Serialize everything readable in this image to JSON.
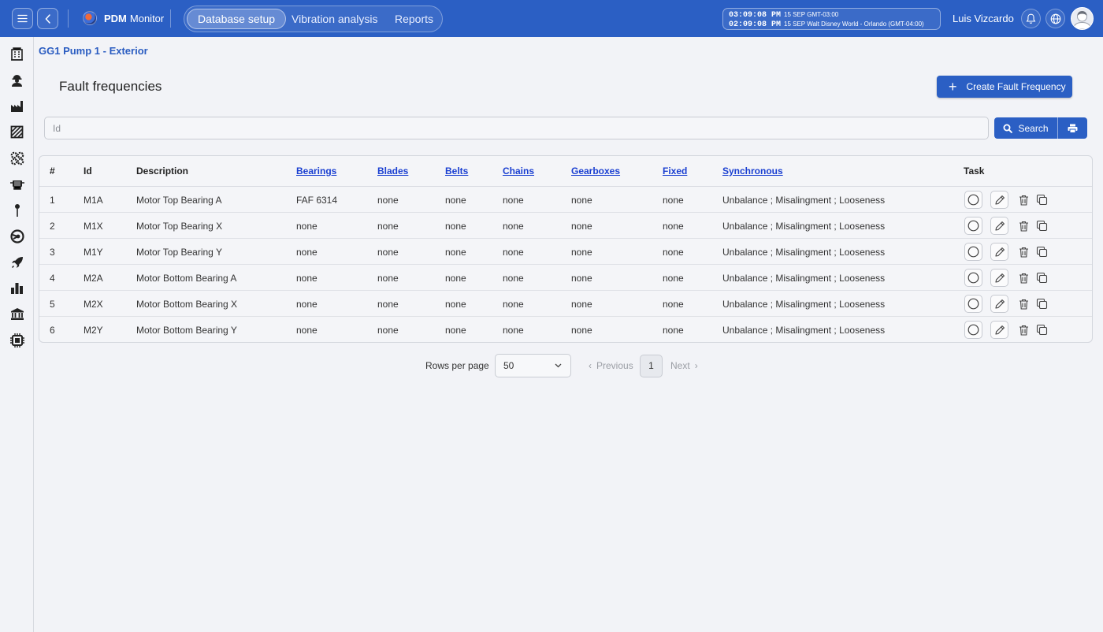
{
  "app": {
    "name_bold": "PDM",
    "name_rest": "Monitor"
  },
  "nav": {
    "tabs": [
      {
        "label": "Database setup",
        "active": true
      },
      {
        "label": "Vibration analysis",
        "active": false
      },
      {
        "label": "Reports",
        "active": false
      }
    ]
  },
  "clock": {
    "line1_time": "03:09:08 PM",
    "line1_info": "15 SEP  GMT-03:00",
    "line2_time": "02:09:08 PM",
    "line2_info": "15 SEP  Walt Disney World - Orlando (GMT-04:00)"
  },
  "user": {
    "name": "Luis Vizcardo"
  },
  "breadcrumb": "GG1 Pump 1 - Exterior",
  "page": {
    "title": "Fault frequencies",
    "create_label": "Create Fault Frequency"
  },
  "search": {
    "placeholder": "Id",
    "button_label": "Search"
  },
  "table": {
    "headers": [
      "#",
      "Id",
      "Description",
      "Bearings",
      "Blades",
      "Belts",
      "Chains",
      "Gearboxes",
      "Fixed",
      "Synchronous",
      "Task"
    ],
    "rows": [
      [
        "1",
        "M1A",
        "Motor Top Bearing A",
        "FAF 6314",
        "none",
        "none",
        "none",
        "none",
        "none",
        "Unbalance ; Misalingment ; Looseness"
      ],
      [
        "2",
        "M1X",
        "Motor Top Bearing X",
        "none",
        "none",
        "none",
        "none",
        "none",
        "none",
        "Unbalance ; Misalingment ; Looseness"
      ],
      [
        "3",
        "M1Y",
        "Motor Top Bearing Y",
        "none",
        "none",
        "none",
        "none",
        "none",
        "none",
        "Unbalance ; Misalingment ; Looseness"
      ],
      [
        "4",
        "M2A",
        "Motor Bottom Bearing A",
        "none",
        "none",
        "none",
        "none",
        "none",
        "none",
        "Unbalance ; Misalingment ; Looseness"
      ],
      [
        "5",
        "M2X",
        "Motor Bottom Bearing X",
        "none",
        "none",
        "none",
        "none",
        "none",
        "none",
        "Unbalance ; Misalingment ; Looseness"
      ],
      [
        "6",
        "M2Y",
        "Motor Bottom Bearing Y",
        "none",
        "none",
        "none",
        "none",
        "none",
        "none",
        "Unbalance ; Misalingment ; Looseness"
      ]
    ]
  },
  "pagination": {
    "rows_label": "Rows per page",
    "rows_value": "50",
    "prev": "Previous",
    "page": "1",
    "next": "Next"
  },
  "colors": {
    "primary": "#2b5fc4",
    "link": "#1a3fd1",
    "background": "#f2f3f7"
  }
}
